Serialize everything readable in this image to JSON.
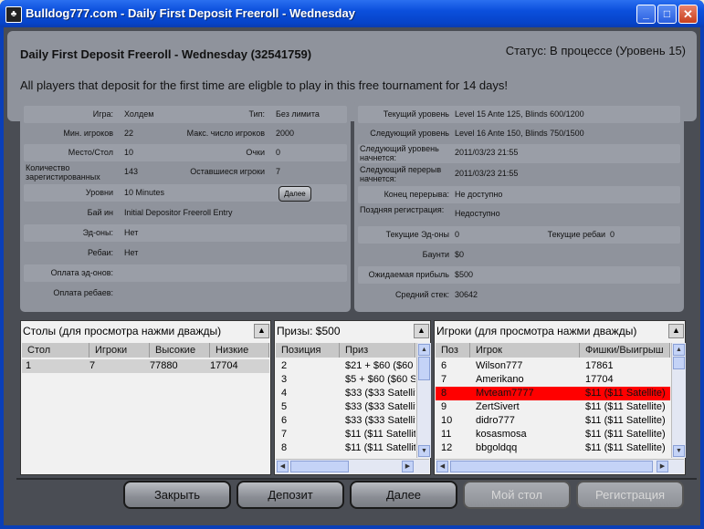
{
  "window": {
    "icon": "bulldog-app-icon",
    "title": "Bulldog777.com - Daily First Deposit Freeroll - Wednesday",
    "controls": {
      "minimize": "_",
      "maximize": "□",
      "close": "✕"
    }
  },
  "header": {
    "title": "Daily First Deposit Freeroll - Wednesday (32541759)",
    "status": "Статус: В процессе (Уровень 15)",
    "description": "All players that deposit for the first time are eligble to play in this free tournament for 14 days!"
  },
  "info_left": {
    "game_label": "Игра:",
    "game_value": "Холдем",
    "type_label": "Тип:",
    "type_value": "Без лимита",
    "min_players_label": "Мин. игроков",
    "min_players_value": "22",
    "max_players_label": "Макс. число игроков",
    "max_players_value": "2000",
    "place_label": "Место/Стол",
    "place_value": "10",
    "points_label": "Очки",
    "points_value": "0",
    "registered_label": "Количество зарегистированных",
    "registered_value": "143",
    "remaining_label": "Оставшиеся игроки",
    "remaining_value": "7",
    "levels_label": "Уровни",
    "levels_value": "10 Minutes",
    "more_button": "Далее",
    "buyin_label": "Бай ин",
    "buyin_value": "Initial Depositor Freeroll Entry",
    "addons_label": "Эд-оны:",
    "addons_value": "Нет",
    "rebuys_label": "Ребаи:",
    "rebuys_value": "Нет",
    "addon_payment_label": "Оплата эд-онов:",
    "addon_payment_value": "",
    "rebuy_payment_label": "Оплата ребаев:",
    "rebuy_payment_value": ""
  },
  "info_right": {
    "current_level_label": "Текущий уровень",
    "current_level_value": "Level 15 Ante 125, Blinds 600/1200",
    "next_level_label": "Следующий уровень",
    "next_level_value": "Level 16 Ante 150, Blinds 750/1500",
    "next_level_start_label": "Следующий уровень начнется:",
    "next_level_start_value": "2011/03/23 21:55",
    "next_break_label": "Следующий перерыв начнется:",
    "next_break_value": "2011/03/23 21:55",
    "break_end_label": "Конец перерыва:",
    "break_end_value": "Не доступно",
    "late_reg_label": "Поздняя регистрация:",
    "late_reg_value": "Недоступно",
    "current_addons_label": "Текущие Эд-оны",
    "current_addons_value": "0",
    "current_rebuys_label": "Текущие ребаи",
    "current_rebuys_value": "0",
    "bounty_label": "Баунти",
    "bounty_value": "$0",
    "expected_prize_label": "Ожидаемая прибыль",
    "expected_prize_value": "$500",
    "avg_stack_label": "Средний стек:",
    "avg_stack_value": "30642"
  },
  "tables_panel": {
    "title": "Столы (для просмотра нажми дважды)",
    "columns": [
      "Стол",
      "Игроки",
      "Высокие",
      "Низкие"
    ],
    "rows": [
      [
        "1",
        "7",
        "77880",
        "17704"
      ]
    ]
  },
  "prizes_panel": {
    "title": "Призы: $500",
    "columns": [
      "Позиция",
      "Приз"
    ],
    "rows": [
      [
        "2",
        "$21 + $60 ($60 S"
      ],
      [
        "3",
        "$5 + $60 ($60 Sa"
      ],
      [
        "4",
        "$33 ($33 Satellite"
      ],
      [
        "5",
        "$33 ($33 Satellite"
      ],
      [
        "6",
        "$33 ($33 Satellite"
      ],
      [
        "7",
        "$11 ($11 Satellite"
      ],
      [
        "8",
        "$11 ($11 Satellite"
      ]
    ]
  },
  "players_panel": {
    "title": "Игроки (для просмотра нажми дважды)",
    "columns": [
      "Поз",
      "Игрок",
      "Фишки/Выигрыш"
    ],
    "rows": [
      [
        "6",
        "Wilson777",
        "17861"
      ],
      [
        "7",
        "Amerikano",
        "17704"
      ],
      [
        "8",
        "Mvteam7777",
        "$11 ($11 Satellite)"
      ],
      [
        "9",
        "ZertSivert",
        "$11 ($11 Satellite)"
      ],
      [
        "10",
        "didro777",
        "$11 ($11 Satellite)"
      ],
      [
        "11",
        "kosasmosa",
        "$11 ($11 Satellite)"
      ],
      [
        "12",
        "bbgoldqq",
        "$11 ($11 Satellite)"
      ]
    ],
    "highlight_color": "#ff0000"
  },
  "buttons": {
    "close": "Закрыть",
    "deposit": "Депозит",
    "more": "Далее",
    "my_table": "Мой стол",
    "register": "Регистрация"
  },
  "colors": {
    "title_bar": "#0b4fdc",
    "background": "#4a4d54",
    "panel": "#8f939c",
    "highlight_row": "#ff0000"
  }
}
